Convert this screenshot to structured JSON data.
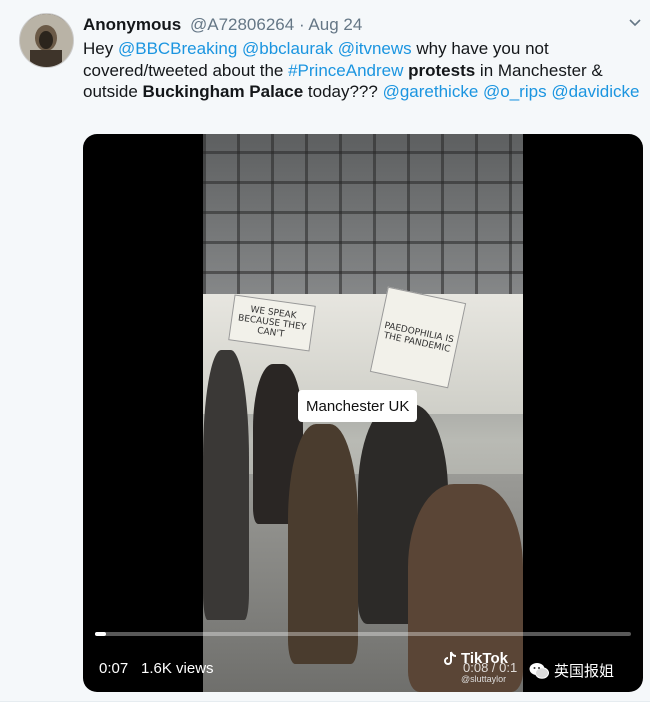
{
  "tweet": {
    "display_name": "Anonymous",
    "handle": "@A72806264",
    "separator": "·",
    "date": "Aug 24",
    "text_parts": [
      {
        "t": "Hey ",
        "style": "plain"
      },
      {
        "t": "@BBCBreaking",
        "style": "mention"
      },
      {
        "t": " ",
        "style": "plain"
      },
      {
        "t": "@bbclaurak",
        "style": "mention"
      },
      {
        "t": " ",
        "style": "plain"
      },
      {
        "t": "@itvnews",
        "style": "mention"
      },
      {
        "t": " why have you not covered/tweeted about the ",
        "style": "plain"
      },
      {
        "t": "#PrinceAndrew",
        "style": "mention"
      },
      {
        "t": " ",
        "style": "plain"
      },
      {
        "t": "protests",
        "style": "bold"
      },
      {
        "t": " in Manchester & outside ",
        "style": "plain"
      },
      {
        "t": "Buckingham Palace",
        "style": "bold"
      },
      {
        "t": " today??? ",
        "style": "plain"
      },
      {
        "t": "@garethicke",
        "style": "mention"
      },
      {
        "t": " ",
        "style": "plain"
      },
      {
        "t": "@o_rips",
        "style": "mention"
      },
      {
        "t": " ",
        "style": "plain"
      },
      {
        "t": "@davidicke",
        "style": "mention"
      }
    ]
  },
  "video": {
    "caption": "Manchester UK",
    "elapsed": "0:07",
    "views": "1.6K views",
    "progress": 0.02,
    "tiktok_brand": "TikTok",
    "tiktok_time": "0:08 / 0:1",
    "tiktok_handle": "@sluttaylor",
    "sign_left": "WE SPEAK BECAUSE THEY CAN'T",
    "sign_right": "PAEDOPHILIA IS THE PANDEMIC"
  },
  "watermark": {
    "label": "英国报姐"
  },
  "colors": {
    "mention": "#1b95e0",
    "text": "#14171a",
    "meta": "#657786",
    "background": "#f5f8fa"
  },
  "icons": [
    "chevron-down-icon",
    "tiktok-icon",
    "wechat-icon"
  ]
}
